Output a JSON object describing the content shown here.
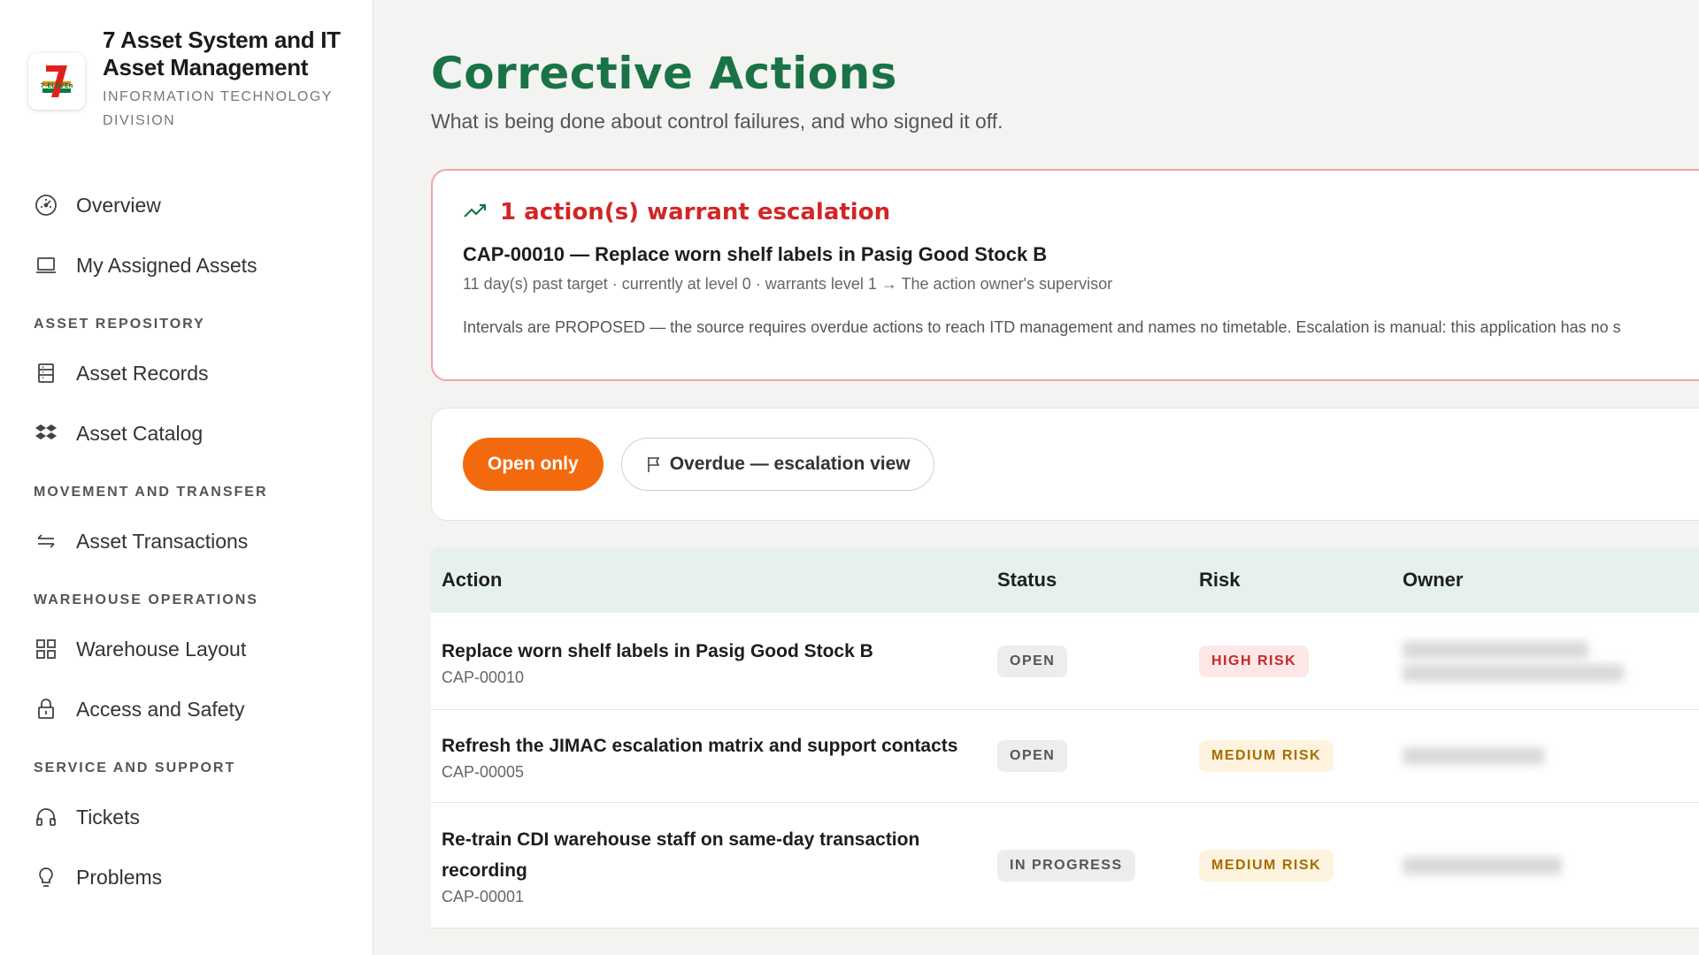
{
  "brand": {
    "title": "7 Asset System and IT Asset Management",
    "subtitle": "INFORMATION TECHNOLOGY DIVISION",
    "logo_text": "7-ELEVEn"
  },
  "sidebar": {
    "top_items": [
      {
        "label": "Overview",
        "icon": "gauge-icon"
      },
      {
        "label": "My Assigned Assets",
        "icon": "laptop-icon"
      }
    ],
    "sections": [
      {
        "title": "ASSET REPOSITORY",
        "items": [
          {
            "label": "Asset Records",
            "icon": "records-icon"
          },
          {
            "label": "Asset Catalog",
            "icon": "boxes-icon"
          }
        ]
      },
      {
        "title": "MOVEMENT AND TRANSFER",
        "items": [
          {
            "label": "Asset Transactions",
            "icon": "transfer-icon"
          }
        ]
      },
      {
        "title": "WAREHOUSE OPERATIONS",
        "items": [
          {
            "label": "Warehouse Layout",
            "icon": "grid-icon"
          },
          {
            "label": "Access and Safety",
            "icon": "lock-icon"
          }
        ]
      },
      {
        "title": "SERVICE AND SUPPORT",
        "items": [
          {
            "label": "Tickets",
            "icon": "headset-icon"
          },
          {
            "label": "Problems",
            "icon": "lightbulb-icon"
          }
        ]
      }
    ]
  },
  "page": {
    "title": "Corrective Actions",
    "subtitle": "What is being done about control failures, and who signed it off."
  },
  "escalation": {
    "heading": "1 action(s) warrant escalation",
    "action": "CAP-00010 — Replace worn shelf labels in Pasig Good Stock B",
    "detail": "11 day(s) past target · currently at level 0 · warrants level 1 → The action owner's supervisor",
    "note": "Intervals are PROPOSED — the source requires overdue actions to reach ITD management and names no timetable. Escalation is manual: this application has no s",
    "accent_color": "#d12626"
  },
  "filters": {
    "open_only": "Open only",
    "overdue_view": "Overdue — escalation view"
  },
  "table": {
    "headers": {
      "action": "Action",
      "status": "Status",
      "risk": "Risk",
      "owner": "Owner"
    },
    "rows": [
      {
        "title": "Replace worn shelf labels in Pasig Good Stock B",
        "id": "CAP-00010",
        "status": "OPEN",
        "risk": "HIGH RISK",
        "risk_level": "high"
      },
      {
        "title": "Refresh the JIMAC escalation matrix and support contacts",
        "id": "CAP-00005",
        "status": "OPEN",
        "risk": "MEDIUM RISK",
        "risk_level": "medium"
      },
      {
        "title": "Re-train CDI warehouse staff on same-day transaction recording",
        "id": "CAP-00001",
        "status": "IN PROGRESS",
        "risk": "MEDIUM RISK",
        "risk_level": "medium"
      }
    ]
  },
  "colors": {
    "brand_green": "#1a7346",
    "accent_orange": "#f26a0d",
    "danger": "#d12626"
  }
}
